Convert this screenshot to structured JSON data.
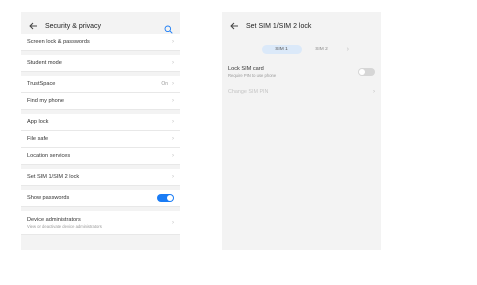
{
  "left": {
    "title": "Security & privacy",
    "back_icon": "back-arrow-icon",
    "search_icon": "search-icon",
    "rows": [
      {
        "label": "Screen lock & passwords"
      },
      {
        "label": "Student mode"
      },
      {
        "label": "TrustSpace",
        "value": "On"
      },
      {
        "label": "Find my phone"
      },
      {
        "label": "App lock"
      },
      {
        "label": "File safe"
      },
      {
        "label": "Location services"
      },
      {
        "label": "Set SIM 1/SIM 2 lock"
      }
    ],
    "show_passwords": {
      "label": "Show passwords",
      "state": "on"
    },
    "device_admin": {
      "label": "Device administrators",
      "subtitle": "View or deactivate device administrators"
    },
    "accent": "#1a7cf5"
  },
  "right": {
    "title": "Set SIM 1/SIM 2 lock",
    "tabs": [
      {
        "label": "SIM 1",
        "active": true
      },
      {
        "label": "SIM 2",
        "active": false
      }
    ],
    "lock_sim": {
      "label": "Lock SIM card",
      "subtitle": "Require PIN to use phone",
      "state": "off"
    },
    "change_pin": {
      "label": "Change SIM PIN"
    }
  }
}
